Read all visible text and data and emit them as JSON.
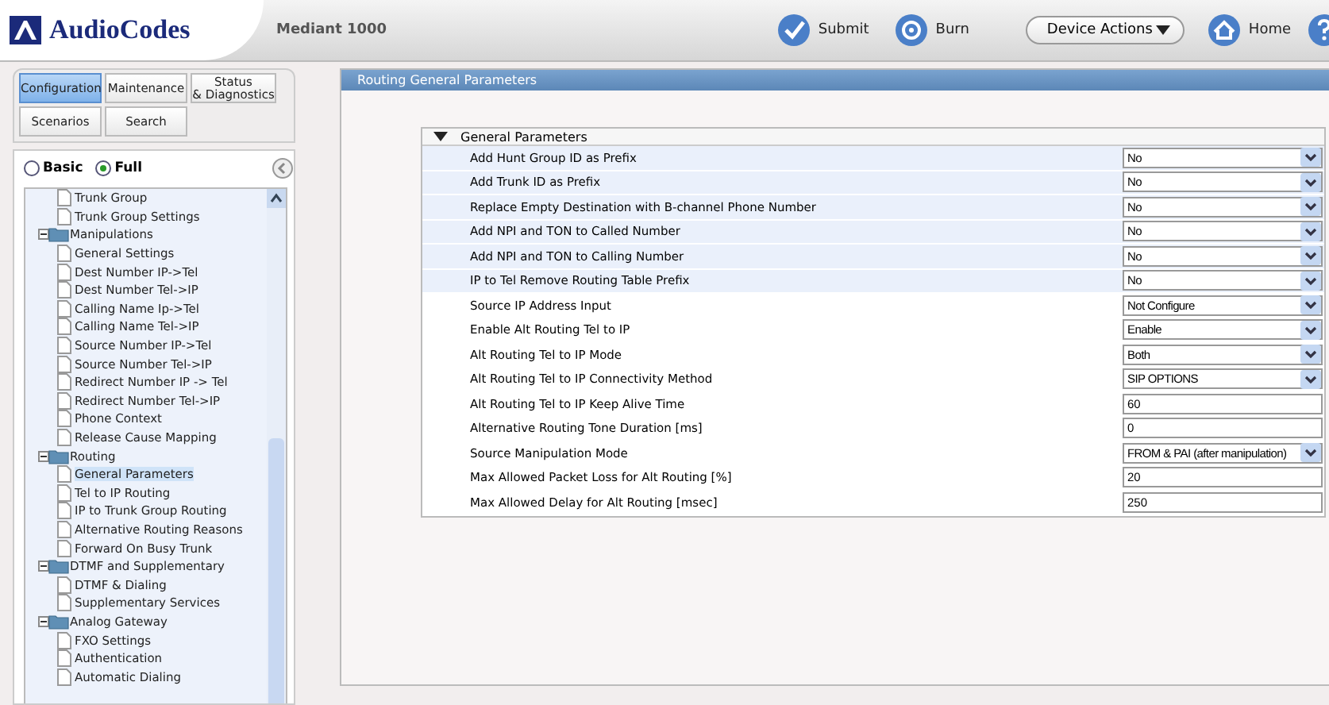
{
  "header": {
    "logo": "AudioCodes",
    "product": "Mediant 1000",
    "actions": [
      {
        "kind": "submit",
        "label": "Submit"
      },
      {
        "kind": "burn",
        "label": "Burn"
      }
    ],
    "device_actions": "Device Actions",
    "home": "Home"
  },
  "nav_tabs": [
    {
      "label": "Configuration",
      "selected": true
    },
    {
      "label": "Maintenance",
      "selected": false
    },
    {
      "label": "Status\n& Diagnostics",
      "selected": false
    },
    {
      "label": "Scenarios",
      "selected": false
    },
    {
      "label": "Search",
      "selected": false
    }
  ],
  "view_mode": [
    {
      "label": "Basic",
      "selected": false
    },
    {
      "label": "Full",
      "selected": true
    }
  ],
  "tree": [
    {
      "label": "Trunk Group",
      "selected": false
    },
    {
      "label": "Trunk Group Settings",
      "selected": false
    },
    {
      "label": "Manipulations",
      "children": [
        {
          "label": "General Settings",
          "selected": false
        },
        {
          "label": "Dest Number IP->Tel",
          "selected": false
        },
        {
          "label": "Dest Number Tel->IP",
          "selected": false
        },
        {
          "label": "Calling Name Ip->Tel",
          "selected": false
        },
        {
          "label": "Calling Name Tel->IP",
          "selected": false
        },
        {
          "label": "Source Number IP->Tel",
          "selected": false
        },
        {
          "label": "Source Number Tel->IP",
          "selected": false
        },
        {
          "label": "Redirect Number IP -> Tel",
          "selected": false
        },
        {
          "label": "Redirect Number Tel->IP",
          "selected": false
        },
        {
          "label": "Phone Context",
          "selected": false
        },
        {
          "label": "Release Cause Mapping",
          "selected": false
        }
      ]
    },
    {
      "label": "Routing",
      "children": [
        {
          "label": "General Parameters",
          "selected": true
        },
        {
          "label": "Tel to IP Routing",
          "selected": false
        },
        {
          "label": "IP to Trunk Group Routing",
          "selected": false
        },
        {
          "label": "Alternative Routing Reasons",
          "selected": false
        },
        {
          "label": "Forward On Busy Trunk",
          "selected": false
        }
      ]
    },
    {
      "label": "DTMF and Supplementary",
      "children": [
        {
          "label": "DTMF & Dialing",
          "selected": false
        },
        {
          "label": "Supplementary Services",
          "selected": false
        }
      ]
    },
    {
      "label": "Analog Gateway",
      "children": [
        {
          "label": "FXO Settings",
          "selected": false
        },
        {
          "label": "Authentication",
          "selected": false
        },
        {
          "label": "Automatic Dialing",
          "selected": false
        }
      ]
    }
  ],
  "page": {
    "title": "Routing General Parameters",
    "section": {
      "title": "General Parameters",
      "expanded": true,
      "rows": [
        {
          "label": "Add Hunt Group ID as Prefix",
          "kind": "select",
          "value": "No",
          "highlighted": true
        },
        {
          "label": "Add Trunk ID as Prefix",
          "kind": "select",
          "value": "No",
          "highlighted": true
        },
        {
          "label": "Replace Empty Destination with B-channel Phone Number",
          "kind": "select",
          "value": "No",
          "highlighted": true
        },
        {
          "label": "Add NPI and TON to Called Number",
          "kind": "select",
          "value": "No",
          "highlighted": true
        },
        {
          "label": "Add NPI and TON to Calling Number",
          "kind": "select",
          "value": "No",
          "highlighted": true
        },
        {
          "label": "IP to Tel Remove Routing Table Prefix",
          "kind": "select",
          "value": "No",
          "highlighted": true
        },
        {
          "label": "Source IP Address Input",
          "kind": "select",
          "value": "Not Configure",
          "highlighted": false
        },
        {
          "label": "Enable Alt Routing Tel to IP",
          "kind": "select",
          "value": "Enable",
          "highlighted": false
        },
        {
          "label": "Alt Routing Tel to IP Mode",
          "kind": "select",
          "value": "Both",
          "highlighted": false
        },
        {
          "label": "Alt Routing Tel to IP Connectivity Method",
          "kind": "select",
          "value": "SIP OPTIONS",
          "highlighted": false
        },
        {
          "label": "Alt Routing Tel to IP Keep Alive Time",
          "kind": "text",
          "value": "60",
          "highlighted": false
        },
        {
          "label": "Alternative Routing Tone Duration [ms]",
          "kind": "text",
          "value": "0",
          "highlighted": false
        },
        {
          "label": "Source Manipulation Mode",
          "kind": "select",
          "value": "FROM & PAI (after manipulation)",
          "highlighted": false
        },
        {
          "label": "Max Allowed Packet Loss for Alt Routing [%]",
          "kind": "text",
          "value": "20",
          "highlighted": false
        },
        {
          "label": "Max Allowed Delay for Alt Routing [msec]",
          "kind": "text",
          "value": "250",
          "highlighted": false
        }
      ]
    }
  }
}
